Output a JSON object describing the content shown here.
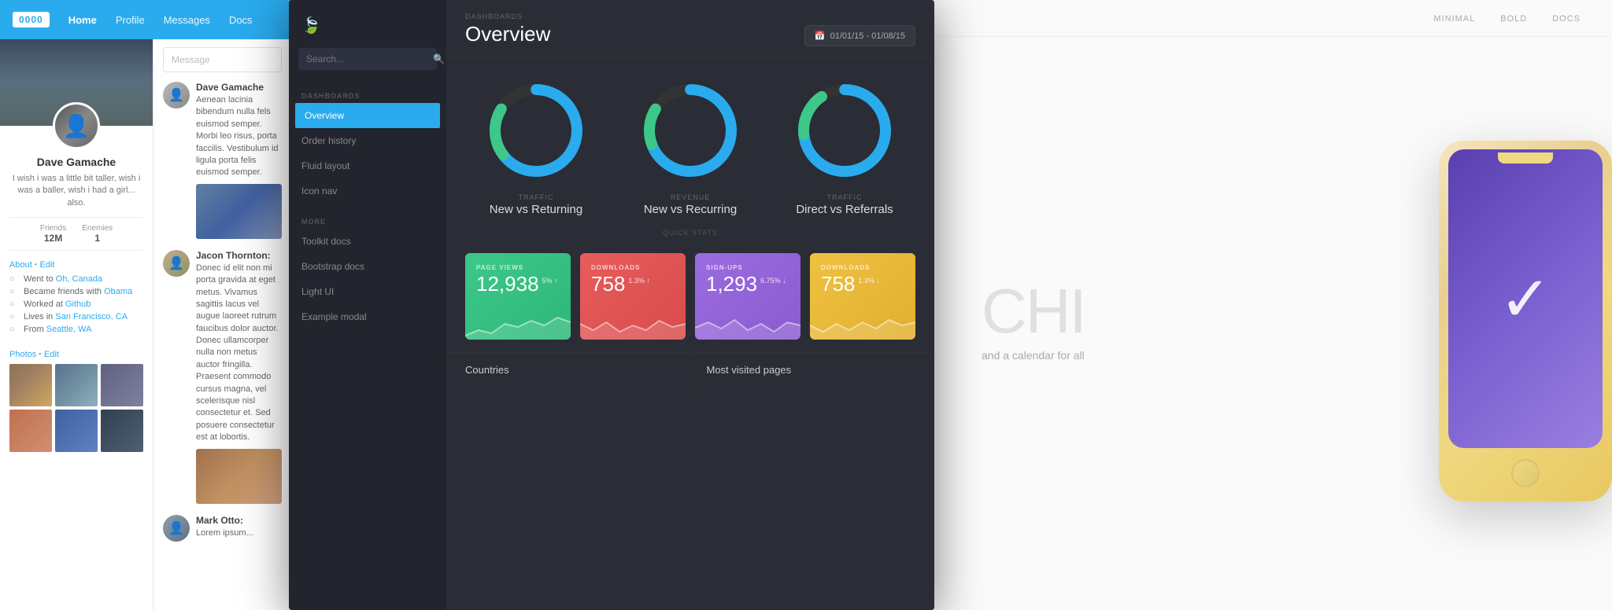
{
  "left": {
    "nav": {
      "logo": "0000",
      "items": [
        "Home",
        "Profile",
        "Messages",
        "Docs"
      ]
    },
    "profile": {
      "name": "Dave Gamache",
      "bio": "I wish i was a little bit taller, wish i was a baller, wish i had a girl... also.",
      "stats": {
        "friends_label": "Friends",
        "friends_val": "12M",
        "enemies_label": "Enemies",
        "enemies_val": "1"
      },
      "about_title": "About",
      "about_edit": "Edit",
      "about_items": [
        {
          "icon": "📍",
          "text": "Went to ",
          "link": "Oh, Canada"
        },
        {
          "icon": "👥",
          "text": "Became friends with ",
          "link": "Obama"
        },
        {
          "icon": "💼",
          "text": "Worked at ",
          "link": "Github"
        },
        {
          "icon": "🏠",
          "text": "Lives in ",
          "link": "San Francisco, CA"
        },
        {
          "icon": "🌍",
          "text": "From ",
          "link": "Seattle, WA"
        }
      ],
      "photos_title": "Photos",
      "photos_edit": "Edit"
    },
    "feed": {
      "message_placeholder": "Message",
      "items": [
        {
          "name": "Dave Gamache",
          "text": "Aenean lacinia bibendum nulla fels euismod semper. Morbi leo risus, porta faccilis. Vestibulum id ligula porta felis euismod semper.",
          "has_image": true
        },
        {
          "name": "Jacon Thornton:",
          "text": "Donec id elit non mi porta gravida at eget metus. Vivamus sagittis lacus vel augue laoreet rutrum faucibus dolor auctor. Donec ullamcorper nulla non metus auctor fringilla. Praesent commodo cursus magna, vel scelerisque nisl consectetur et. Sed posuere consectetur est at lobortis.",
          "has_image": true
        },
        {
          "name": "Mark Otto:",
          "text": "Lorem ipsum...",
          "has_image": false
        }
      ]
    }
  },
  "dashboard": {
    "breadcrumb": "DASHBOARDS",
    "title": "Overview",
    "date_range": "01/01/15 - 01/08/15",
    "search_placeholder": "Search...",
    "nav": {
      "section1_label": "DASHBOARDS",
      "section1_items": [
        "Overview",
        "Order history",
        "Fluid layout",
        "Icon nav"
      ],
      "section2_label": "MORE",
      "section2_items": [
        "Toolkit docs",
        "Bootstrap docs",
        "Light UI",
        "Example modal"
      ]
    },
    "charts": [
      {
        "type_label": "Traffic",
        "title": "New vs Returning",
        "segments": [
          {
            "color": "#2AABEE",
            "percent": 65,
            "gap": 35
          },
          {
            "color": "#3DC88A",
            "percent": 20,
            "gap": 80
          }
        ]
      },
      {
        "type_label": "Revenue",
        "title": "New vs Recurring",
        "segments": [
          {
            "color": "#2AABEE",
            "percent": 70,
            "gap": 30
          },
          {
            "color": "#3DC88A",
            "percent": 15,
            "gap": 85
          }
        ]
      },
      {
        "type_label": "Traffic",
        "title": "Direct vs Referrals",
        "segments": [
          {
            "color": "#2AABEE",
            "percent": 75,
            "gap": 25
          },
          {
            "color": "#3DC88A",
            "percent": 18,
            "gap": 82
          }
        ]
      }
    ],
    "quick_stats_label": "QUICK STATS",
    "stat_cards": [
      {
        "label": "PAGE VIEWS",
        "value": "12,938",
        "change": "5% ↑",
        "color": "green"
      },
      {
        "label": "DOWNLOADS",
        "value": "758",
        "change": "1.3% ↑",
        "color": "red"
      },
      {
        "label": "SIGN-UPS",
        "value": "1,293",
        "change": "6.75% ↓",
        "color": "purple"
      },
      {
        "label": "DOWNLOADS",
        "value": "758",
        "change": "1.3% ↓",
        "color": "yellow"
      }
    ],
    "bottom_sections": [
      {
        "title": "Countries"
      },
      {
        "title": "Most visited pages"
      }
    ]
  },
  "right": {
    "nav_items": [
      "MINIMAL",
      "BOLD",
      "DOCS"
    ],
    "heading": "CHI",
    "subtext": "and a calendar for all",
    "phone": {
      "checkmark": "✓"
    }
  }
}
